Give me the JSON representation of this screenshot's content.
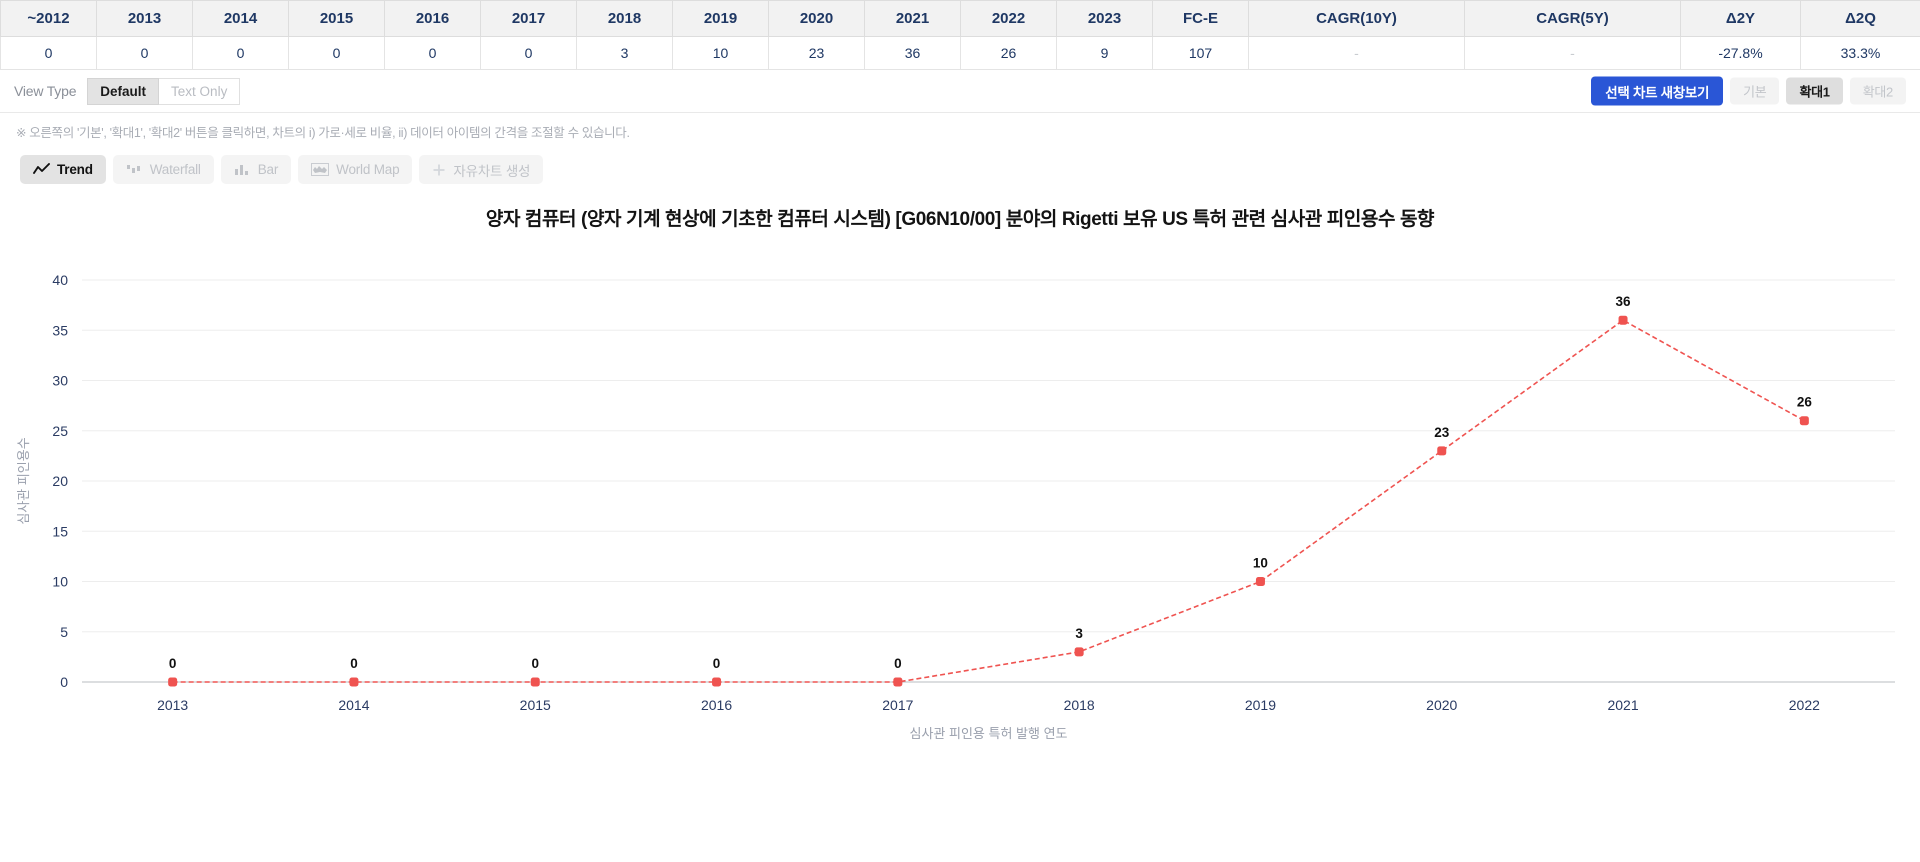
{
  "summary": {
    "columns": [
      "~2012",
      "2013",
      "2014",
      "2015",
      "2016",
      "2017",
      "2018",
      "2019",
      "2020",
      "2021",
      "2022",
      "2023",
      "FC-E",
      "CAGR(10Y)",
      "CAGR(5Y)",
      "Δ2Y",
      "Δ2Q"
    ],
    "values": [
      "0",
      "0",
      "0",
      "0",
      "0",
      "0",
      "3",
      "10",
      "23",
      "36",
      "26",
      "9",
      "107",
      "-",
      "-",
      "-27.8%",
      "33.3%"
    ]
  },
  "toolbar": {
    "view_type_label": "View Type",
    "view_options": [
      "Default",
      "Text Only"
    ],
    "view_selected": "Default",
    "open_new_window_label": "선택 차트 새창보기",
    "zoom_options": [
      "기본",
      "확대1",
      "확대2"
    ],
    "zoom_selected": "확대1"
  },
  "notice": "※ 오른쪽의 '기본', '확대1', '확대2' 버튼을 클릭하면, 차트의 i) 가로·세로 비율, ii) 데이터 아이템의 간격을 조절할 수 있습니다.",
  "chart_tabs": [
    {
      "label": "Trend",
      "icon": "line-chart-icon",
      "active": true
    },
    {
      "label": "Waterfall",
      "icon": "waterfall-icon",
      "active": false
    },
    {
      "label": "Bar",
      "icon": "bar-chart-icon",
      "active": false
    },
    {
      "label": "World Map",
      "icon": "world-map-icon",
      "active": false
    },
    {
      "label": "자유차트 생성",
      "icon": "plus-icon",
      "active": false
    }
  ],
  "colors": {
    "accent": "#2a56d6",
    "series": "#ef5350",
    "grid": "#ededed",
    "axis": "#9aa0ad"
  },
  "chart_data": {
    "type": "line",
    "title": "양자 컴퓨터 (양자 기계 현상에 기초한 컴퓨터 시스템) [G06N10/00] 분야의 Rigetti 보유 US 특허 관련 심사관 피인용수 동향",
    "xlabel": "심사관 피인용 특허 발행 연도",
    "ylabel": "심사관 피인용수",
    "categories": [
      "2013",
      "2014",
      "2015",
      "2016",
      "2017",
      "2018",
      "2019",
      "2020",
      "2021",
      "2022"
    ],
    "values": [
      0,
      0,
      0,
      0,
      0,
      3,
      10,
      23,
      36,
      26
    ],
    "data_labels": [
      "0",
      "0",
      "0",
      "0",
      "0",
      "3",
      "10",
      "23",
      "36",
      "26"
    ],
    "yticks": [
      0,
      5,
      10,
      15,
      20,
      25,
      30,
      35,
      40
    ],
    "ylim": [
      0,
      40
    ],
    "grid": true,
    "legend": "none"
  }
}
